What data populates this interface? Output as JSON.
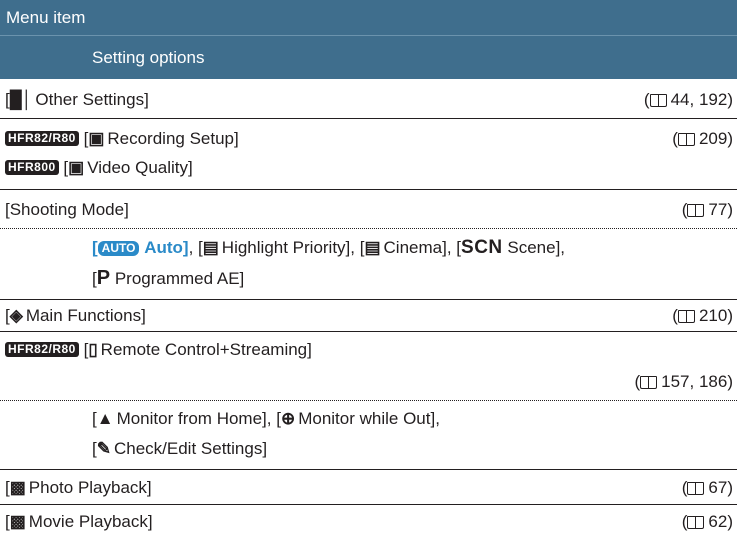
{
  "header": {
    "menu_item": "Menu item",
    "setting_options": "Setting options"
  },
  "rows": [
    {
      "label": "Other Settings]",
      "ref": "44, 192"
    },
    {
      "model": "HFR82/R80",
      "label": "Recording Setup]",
      "ref": "209"
    },
    {
      "model": "HFR800",
      "label": "Video Quality]"
    },
    {
      "label": "[Shooting Mode]",
      "ref": "77"
    },
    {
      "label": "Main Functions]",
      "ref": "210"
    },
    {
      "model": "HFR82/R80",
      "label": "Remote Control+Streaming]",
      "ref": "157, 186"
    },
    {
      "label": "Photo Playback]",
      "ref": "67"
    },
    {
      "label": "Movie Playback]",
      "ref": "62"
    }
  ],
  "shooting_options": {
    "auto_icon": "AUTO",
    "auto": "Auto]",
    "highlight": "Highlight Priority],",
    "cinema": "Cinema],",
    "scn_icon": "SCN",
    "scene": "Scene],",
    "p_icon": "P",
    "programmed": "Programmed AE]"
  },
  "remote_options": {
    "monitor_home": "Monitor from Home],",
    "monitor_out": "Monitor while Out],",
    "check_edit": "Check/Edit Settings]"
  },
  "icons": [
    "other-settings-icon",
    "recording-setup-icon",
    "highlight-priority-icon",
    "cinema-icon",
    "main-functions-icon",
    "remote-icon",
    "monitor-home-icon",
    "monitor-out-icon",
    "wrench-icon",
    "camera-icon",
    "movie-icon",
    "book-icon"
  ],
  "colors": {
    "header": "#3f6e8d",
    "accent": "#2a8ac8"
  }
}
